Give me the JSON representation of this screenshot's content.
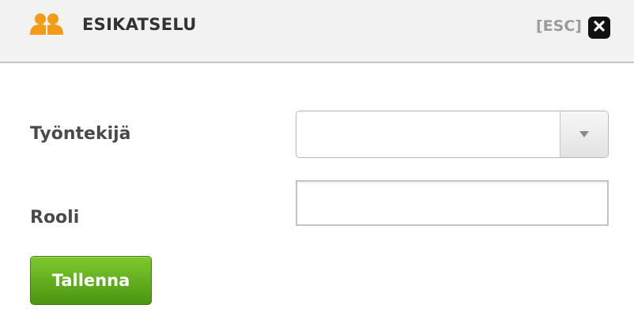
{
  "header": {
    "title": "ESIKATSELU",
    "icon": "users-icon",
    "esc_label": "[ESC]",
    "close_icon": "close-icon"
  },
  "form": {
    "employee_label": "Työntekijä",
    "employee_select_value": "",
    "role_label": "Rooli",
    "role_value": "",
    "save_label": "Tallenna"
  },
  "colors": {
    "icon_orange": "#f39a16",
    "save_button_green": "#5fae1e",
    "header_background": "#f2f2f2"
  }
}
